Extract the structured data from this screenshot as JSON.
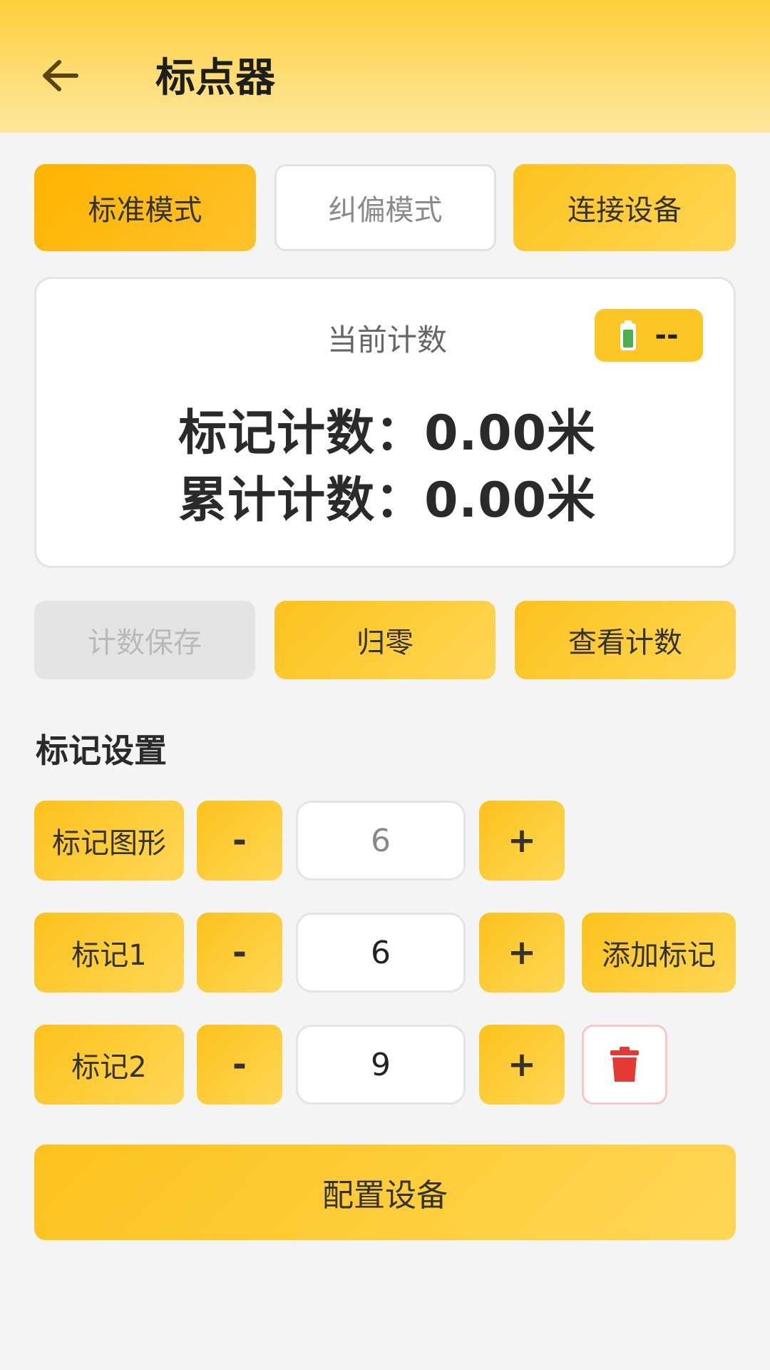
{
  "header": {
    "title": "标点器",
    "back_icon": "arrow-left-icon"
  },
  "modes": {
    "standard": "标准模式",
    "correction": "纠偏模式",
    "connect": "连接设备"
  },
  "counter": {
    "title": "当前计数",
    "battery_text": "--",
    "battery_icon": "battery-icon",
    "mark_label": "标记计数：",
    "mark_value": "0.00米",
    "total_label": "累计计数：",
    "total_value": "0.00米"
  },
  "actions": {
    "save": "计数保存",
    "reset": "归零",
    "view": "查看计数"
  },
  "settings": {
    "title": "标记设置",
    "rows": [
      {
        "label": "标记图形",
        "minus": "-",
        "value": "6",
        "plus": "+"
      },
      {
        "label": "标记1",
        "minus": "-",
        "value": "6",
        "plus": "+",
        "extra": "添加标记"
      },
      {
        "label": "标记2",
        "minus": "-",
        "value": "9",
        "plus": "+",
        "extra_icon": "trash-icon"
      }
    ]
  },
  "configure": "配置设备",
  "colors": {
    "accent": "#fdc21c",
    "accent_dark": "#ffb300",
    "delete": "#e53935",
    "battery_green": "#4caf50"
  }
}
